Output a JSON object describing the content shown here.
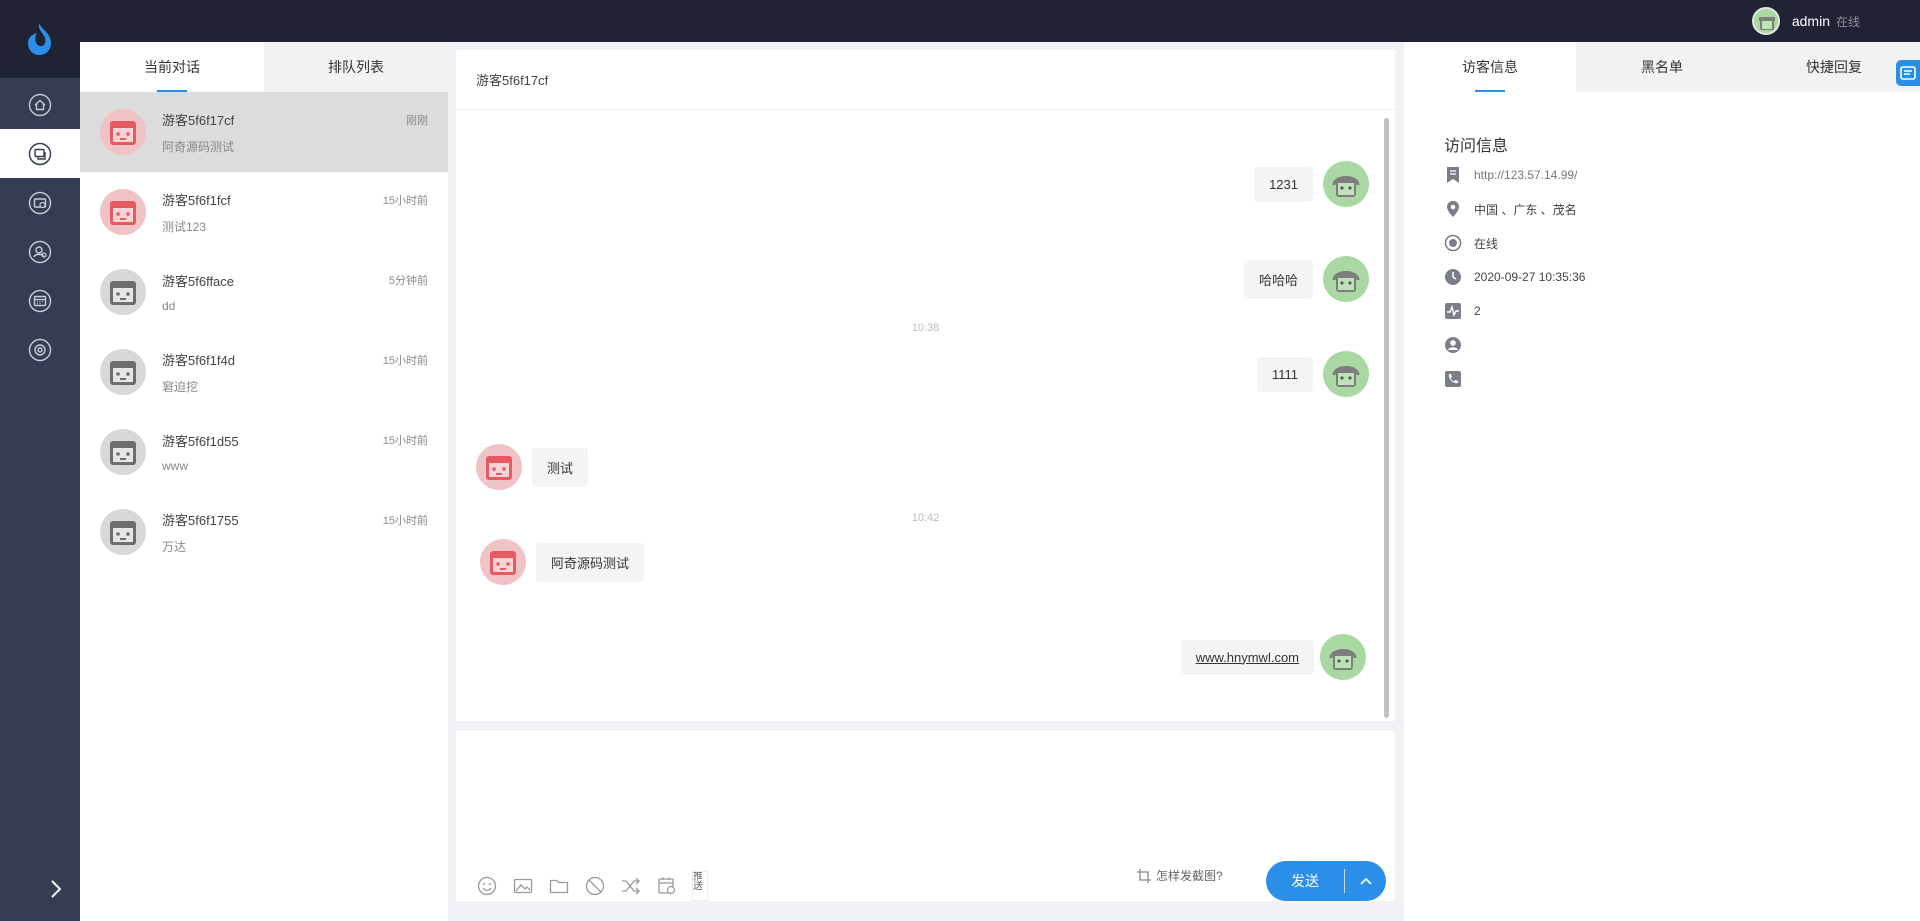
{
  "topbar": {
    "username": "admin",
    "status": "在线"
  },
  "left_tabs": {
    "current": "当前对话",
    "queue": "排队列表"
  },
  "conversations": [
    {
      "name": "游客5f6f17cf",
      "preview": "阿奇源码测试",
      "time": "刚刚"
    },
    {
      "name": "游客5f6f1fcf",
      "preview": "测试123",
      "time": "15小时前"
    },
    {
      "name": "游客5f6fface",
      "preview": "dd",
      "time": "5分钟前"
    },
    {
      "name": "游客5f6f1f4d",
      "preview": "窘迫挖",
      "time": "15小时前"
    },
    {
      "name": "游客5f6f1d55",
      "preview": "www",
      "time": "15小时前"
    },
    {
      "name": "游客5f6f1755",
      "preview": "万达",
      "time": "15小时前"
    }
  ],
  "chat": {
    "title": "游客5f6f17cf",
    "messages": [
      {
        "text": "1231"
      },
      {
        "text": "哈哈哈"
      },
      {
        "text": "1111"
      },
      {
        "text": "测试"
      },
      {
        "text": "阿奇源码测试"
      },
      {
        "text": "www.hnymwl.com"
      }
    ],
    "timestamps": [
      "10:38",
      "10:42"
    ]
  },
  "composer": {
    "push_alt": "推送",
    "screenshot_tip": "怎样发截图?",
    "send_label": "发送"
  },
  "right_tabs": {
    "visitor": "访客信息",
    "blacklist": "黑名单",
    "quick_reply": "快捷回复"
  },
  "visitor_info": {
    "title": "访问信息",
    "url": "http://123.57.14.99/",
    "location": "中国 、广东 、茂名",
    "status": "在线",
    "time": "2020-09-27 10:35:36",
    "visits": "2",
    "name": "",
    "phone": ""
  },
  "colors": {
    "accent": "#2a8fe8",
    "topbar": "#1f2333",
    "sidebar": "#353d52"
  },
  "icons": [
    "home-icon",
    "chat-icon",
    "history-icon",
    "user-icon",
    "calendar-icon",
    "settings-icon"
  ]
}
